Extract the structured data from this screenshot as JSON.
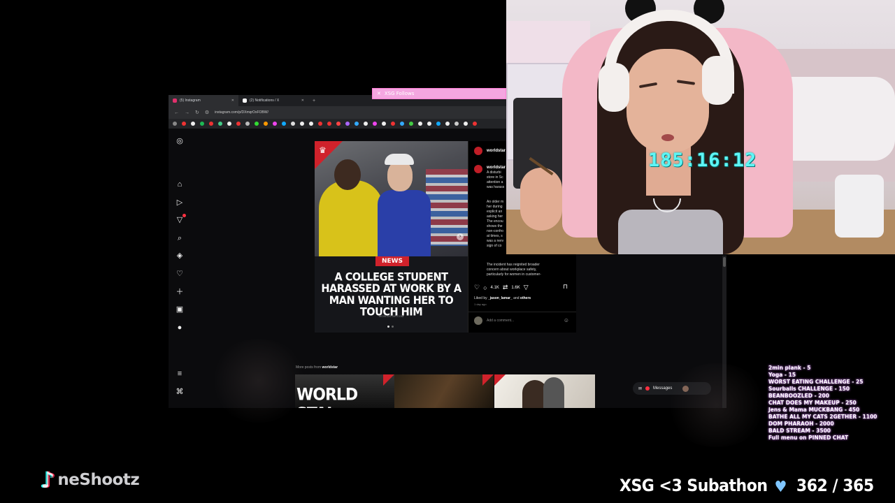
{
  "browser": {
    "tabs": [
      {
        "label": "(5) Instagram",
        "fav_color": "#e1306c"
      },
      {
        "label": "(2) Notifications / X",
        "fav_color": "#ffffff"
      }
    ],
    "url": "instagram.com/p/DXmqrOxFOBW/",
    "bookmark_colors": [
      "#888",
      "#e33",
      "#eee",
      "#1db954",
      "#e33",
      "#4c8",
      "#eee",
      "#e33",
      "#bbb",
      "#3d3",
      "#f90",
      "#e4e",
      "#1af",
      "#ddd",
      "#eee",
      "#eee",
      "#e33",
      "#e33",
      "#f44",
      "#a6f",
      "#3af",
      "#eee",
      "#e4e",
      "#eee",
      "#e33",
      "#3af",
      "#4c4",
      "#eee",
      "#eee",
      "#1af",
      "#eee",
      "#ccc",
      "#eee",
      "#e33"
    ]
  },
  "instagram": {
    "sidebar_icons": [
      "instagram-icon",
      "home-icon",
      "reels-icon",
      "notifications-icon",
      "search-icon",
      "explore-icon",
      "heart-icon",
      "create-icon",
      "dashboard-icon",
      "profile-avatar",
      "menu-icon",
      "threads-icon"
    ],
    "post": {
      "news_tag": "NEWS",
      "headline": "A COLLEGE STUDENT HARASSED AT WORK BY A MAN WANTING HER TO TOUCH HIM",
      "source_url": "WORLDSTAR.COM",
      "username": "worldstar",
      "caption_user": "worldstar",
      "caption_lines": [
        "A disturbi",
        "store in Sc",
        "attention a",
        "was harass"
      ],
      "caption_lines2": [
        "An older m",
        "her during",
        "explicit an",
        "asking her",
        "The encou",
        "shows the",
        "non-confro",
        "at times, s",
        "was a nerv",
        "sign of co"
      ],
      "caption_tail": [
        "The incident has reignited broader",
        "concern about workplace safety,",
        "particularly for women in customer-"
      ],
      "likes": "4.1K",
      "comments": "1.6K",
      "liked_by_prefix": "Liked by ",
      "liked_by_user": "_jason_lamar_",
      "liked_by_and": " and ",
      "liked_by_others": "others",
      "time_ago": "1 day ago",
      "comment_placeholder": "Add a comment..."
    },
    "more_posts_prefix": "More posts from ",
    "more_posts_user": "worldstar",
    "thumb1_text": "WORLD STAI",
    "messages_label": "Messages"
  },
  "alert": {
    "text": "XSG Follows"
  },
  "stream": {
    "timer": "185:16:12",
    "goals": [
      "2min plank - 5",
      "Yoga - 15",
      "WORST EATING CHALLENGE - 25",
      "Sourballs CHALLENGE - 150",
      "BEANBOOZLED - 200",
      "CHAT DOES MY MAKEUP - 250",
      "Jens & Mama MUCKBANG - 450",
      "BATHE ALL MY CATS 2GETHER - 1100",
      "DOM PHARAOH - 2000",
      "BALD STREAM - 3500",
      "Full menu on PINNED CHAT"
    ],
    "tiktok_handle": "neShootz",
    "subathon_label": "XSG <3 Subathon",
    "subathon_count": "362 / 365"
  },
  "colors": {
    "accent_pink": "#f4a6e0",
    "timer_cyan": "#5ff5f5",
    "worldstar_red": "#d0222b",
    "ig_badge": "#ff3040"
  }
}
